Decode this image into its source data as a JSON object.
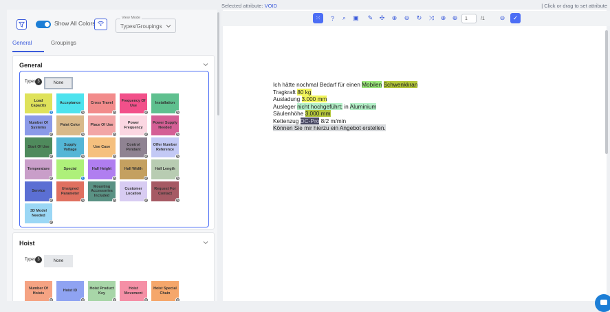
{
  "status": {
    "selected_attribute_label": "Selected attribute:",
    "selected_attribute_value": "VOID",
    "hint": "| Click or drag to set attribute"
  },
  "filter_bar": {
    "show_all_colors_label": "Show All Colors",
    "view_mode_legend": "View Mode",
    "view_mode_value": "Types/Groupings",
    "show_all_on": true
  },
  "tabs": [
    {
      "label": "General",
      "active": true
    },
    {
      "label": "Groupings",
      "active": false
    }
  ],
  "sections": {
    "general": {
      "title": "General",
      "types_label": "Types",
      "types_count": "3",
      "none_label": "None",
      "tiles": [
        {
          "label": "Load Capacity",
          "color": "#dfe25a",
          "badge": "2",
          "badge_color": "#1c7ed6"
        },
        {
          "label": "Acceptance",
          "color": "#4de3ee",
          "badge": "0"
        },
        {
          "label": "Cross Travel",
          "color": "#f28b8b",
          "badge": "0"
        },
        {
          "label": "Frequency Of Use",
          "color": "#f2508a",
          "badge": "0"
        },
        {
          "label": "Installation",
          "color": "#5fc08f",
          "badge": "0"
        },
        {
          "label": "Number Of Systems",
          "color": "#8b9ae8",
          "badge": "0"
        },
        {
          "label": "Paint Color",
          "color": "#d8b98a",
          "badge": "0"
        },
        {
          "label": "Place Of Use",
          "color": "#f2a6a6",
          "badge": "0"
        },
        {
          "label": "Power Frequency",
          "color": "#fbd7e2",
          "badge": "0"
        },
        {
          "label": "Power Supply Needed",
          "color": "#d45f95",
          "badge": "0"
        },
        {
          "label": "Start Of Use",
          "color": "#4f8a5c",
          "badge": "0"
        },
        {
          "label": "Supply Voltage",
          "color": "#54b6d6",
          "badge": "0"
        },
        {
          "label": "Use Case",
          "color": "#f5c07e",
          "badge": "0"
        },
        {
          "label": "Control Pendant",
          "color": "#8f8392",
          "badge": "0"
        },
        {
          "label": "Offer Number Reference",
          "color": "#c3c9f5",
          "badge": "0"
        },
        {
          "label": "Temperature",
          "color": "#c99ec9",
          "badge": "0"
        },
        {
          "label": "Special",
          "color": "#aef07a",
          "badge": "1",
          "badge_color": "#1c7ed6"
        },
        {
          "label": "Hall Height",
          "color": "#b07ef0",
          "badge": "0"
        },
        {
          "label": "Hall Width",
          "color": "#c4a060",
          "badge": "0"
        },
        {
          "label": "Hall Length",
          "color": "#b8ccb2",
          "badge": "0"
        },
        {
          "label": "Service",
          "color": "#5b6fd3",
          "badge": "0"
        },
        {
          "label": "Unsigned Parameter",
          "color": "#e07060",
          "badge": "0"
        },
        {
          "label": "Mounting Accessories Included",
          "color": "#5a9284",
          "badge": "0"
        },
        {
          "label": "Customer Location",
          "color": "#d8ccf2",
          "badge": "0"
        },
        {
          "label": "Request For Contact",
          "color": "#a65a64",
          "badge": "0"
        },
        {
          "label": "3D Model Needed",
          "color": "#9bd7f5",
          "badge": "0"
        }
      ]
    },
    "hoist": {
      "title": "Hoist",
      "types_label": "Types",
      "types_count": "3",
      "none_label": "None",
      "tiles": [
        {
          "label": "Number Of Hoists",
          "color": "#f5a383",
          "badge": "0"
        },
        {
          "label": "Hoist ID",
          "color": "#8fa3f2",
          "badge": "0"
        },
        {
          "label": "Hoist Product Key",
          "color": "#a8d6a8",
          "badge": "0"
        },
        {
          "label": "Hoist Movement",
          "color": "#f58fa6",
          "badge": "0"
        },
        {
          "label": "Hoist Special Chain",
          "color": "#f5a76b",
          "badge": "0"
        }
      ]
    }
  },
  "toolbar": {
    "page_current": "1",
    "page_total": "/1",
    "icons": [
      "select-icon",
      "help-icon",
      "search-icon",
      "save-icon",
      "pen-icon",
      "move-icon",
      "zoom-in-icon",
      "zoom-out-icon",
      "rotate-icon",
      "shuffle-icon",
      "add-icon",
      "add-circle-icon"
    ]
  },
  "document": {
    "lines": [
      [
        {
          "t": "Ich hätte nochmal Bedarf für einen "
        },
        {
          "t": "Mobilen",
          "h": "green"
        },
        {
          "t": " "
        },
        {
          "t": "Schwenkkran",
          "h": "olive"
        }
      ],
      [
        {
          "t": "Tragkraft "
        },
        {
          "t": "80 kg",
          "h": "yellow"
        }
      ],
      [
        {
          "t": "Ausladung "
        },
        {
          "t": "3.000 mm",
          "h": "yellow"
        }
      ],
      [
        {
          "t": "Ausleger "
        },
        {
          "t": "nicht hochgeführt;",
          "h": "mint"
        },
        {
          "t": " in "
        },
        {
          "t": "Aluminium",
          "h": "mint"
        }
      ],
      [
        {
          "t": "Säulenhöhe "
        },
        {
          "t": "3.000 mm",
          "h": "olive"
        }
      ],
      [
        {
          "t": "Kettenzug "
        },
        {
          "t": "DC-Pro",
          "h": "dark"
        },
        {
          "t": " 8/2 m/min"
        }
      ],
      [
        {
          "t": "Können Sie mir hierzu ein Angebot erstellen.",
          "h": "gray"
        }
      ]
    ]
  }
}
